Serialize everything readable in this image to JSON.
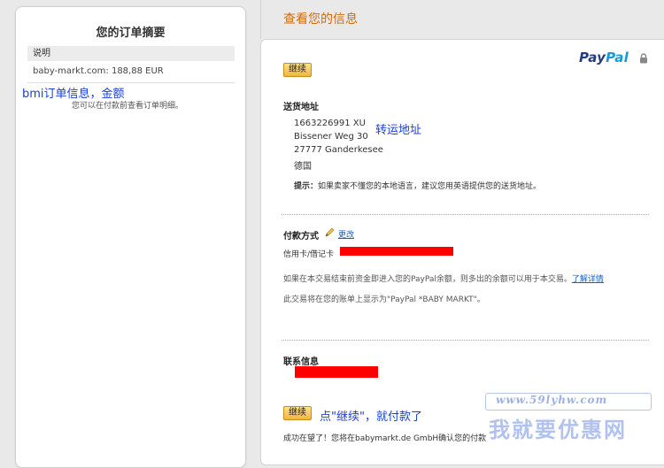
{
  "summary": {
    "title": "您的订单摘要",
    "desc_header": "说明",
    "merchant_line": "baby-markt.com: 188,88 EUR",
    "note": "您可以在付款前查看订单明细。",
    "annotation": "bmi订单信息，金额"
  },
  "review": {
    "heading": "查看您的信息",
    "continue_label": "继续",
    "logo_pay": "Pay",
    "logo_pal": "Pal"
  },
  "shipping": {
    "title": "送货地址",
    "lines": [
      "1663226991 XU",
      "Bissener Weg 30",
      "27777 Ganderkesee",
      "德国"
    ],
    "annotation": "转运地址",
    "tip_label": "提示：",
    "tip_text": "如果卖家不懂您的本地语言，建议您用英语提供您的送货地址。"
  },
  "payment": {
    "title": "付款方式",
    "change_label": "更改",
    "card_label": "信用卡/借记卡",
    "balance_text": "如果在本交易结束前资金即进入您的PayPal余额，则多出的余额可以用于本交易。",
    "learn_more": "了解详情",
    "statement_text": "此交易将在您的账单上显示为\"PayPal *BABY MARKT\"。"
  },
  "contact": {
    "title": "联系信息"
  },
  "footer": {
    "continue_label": "继续",
    "annotation": "点\"继续\"，就付款了",
    "success_text": "成功在望了！您将在babymarkt.de GmbH确认您的付款"
  },
  "watermark": {
    "url": "www.59lyhw.com",
    "text": "我就要优惠网"
  },
  "colors": {
    "heading": "#d36a0b",
    "annotation": "#1a3fd6",
    "redaction": "#ff0000",
    "paypal_dark": "#253b80",
    "paypal_light": "#179bd7"
  }
}
